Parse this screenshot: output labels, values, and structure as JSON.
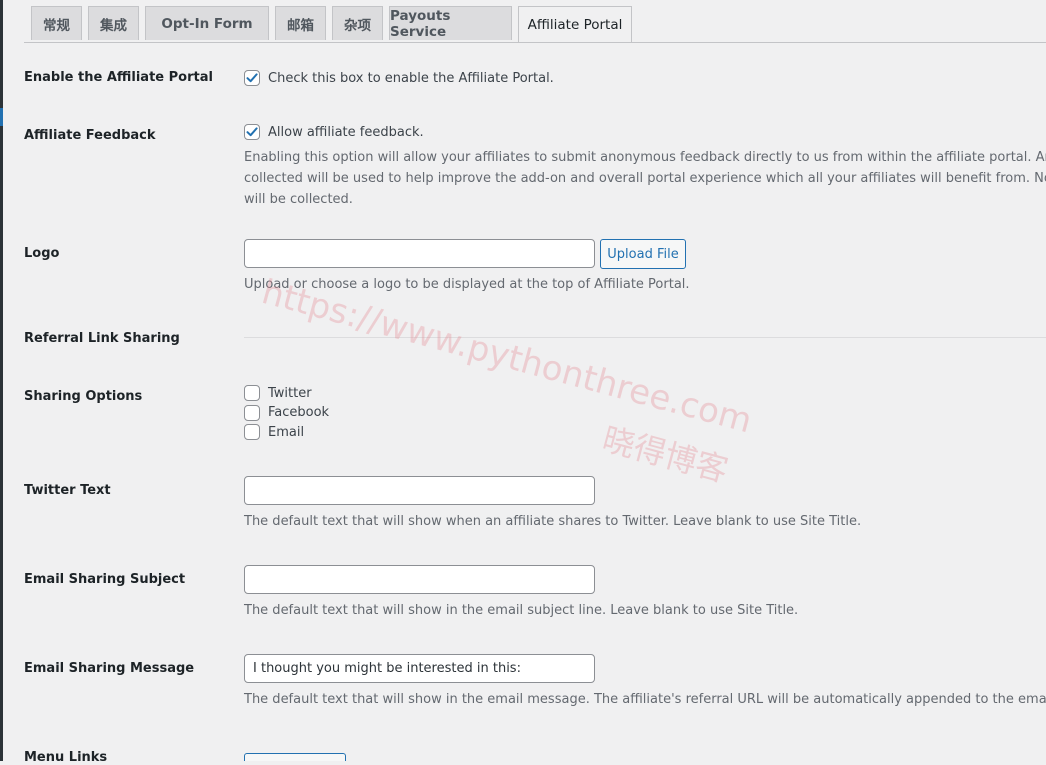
{
  "tabs": [
    {
      "label": "常规",
      "active": false
    },
    {
      "label": "集成",
      "active": false
    },
    {
      "label": "Opt-In Form",
      "active": false
    },
    {
      "label": "邮箱",
      "active": false
    },
    {
      "label": "杂项",
      "active": false
    },
    {
      "label": "Payouts Service",
      "active": false
    },
    {
      "label": "Affiliate Portal",
      "active": true
    }
  ],
  "enable_portal": {
    "label": "Enable the Affiliate Portal",
    "checkbox_text": "Check this box to enable the Affiliate Portal.",
    "checked": true
  },
  "feedback": {
    "label": "Affiliate Feedback",
    "checkbox_text": "Allow affiliate feedback.",
    "checked": true,
    "desc_line1": "Enabling this option will allow your affiliates to submit anonymous feedback directly to us from within the affiliate portal. Any feed",
    "desc_line2": "collected will be used to help improve the add-on and overall portal experience which all your affiliates will benefit from. No perso",
    "desc_line3": "will be collected."
  },
  "logo": {
    "label": "Logo",
    "value": "",
    "upload_label": "Upload File",
    "desc": "Upload or choose a logo to be displayed at the top of Affiliate Portal."
  },
  "referral_heading": "Referral Link Sharing",
  "sharing": {
    "label": "Sharing Options",
    "options": [
      {
        "label": "Twitter",
        "checked": false
      },
      {
        "label": "Facebook",
        "checked": false
      },
      {
        "label": "Email",
        "checked": false
      }
    ]
  },
  "twitter_text": {
    "label": "Twitter Text",
    "value": "",
    "desc": "The default text that will show when an affiliate shares to Twitter. Leave blank to use Site Title."
  },
  "email_subject": {
    "label": "Email Sharing Subject",
    "value": "",
    "desc": "The default text that will show in the email subject line. Leave blank to use Site Title."
  },
  "email_message": {
    "label": "Email Sharing Message",
    "value": "I thought you might be interested in this:",
    "desc": "The default text that will show in the email message. The affiliate's referral URL will be automatically appended to the email."
  },
  "menu_links": {
    "label": "Menu Links"
  },
  "watermark": {
    "url": "https://www.pythonthree.com",
    "name": "晓得博客"
  },
  "colors": {
    "accent": "#2271b1",
    "label": "#1d2327",
    "description": "#646970",
    "background": "#f0f0f1"
  }
}
